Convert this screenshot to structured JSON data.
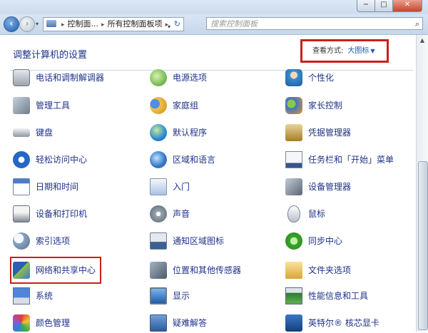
{
  "window": {
    "controls": {
      "minimize": "−",
      "maximize": "□",
      "close": "✕"
    }
  },
  "navbar": {
    "breadcrumb": [
      "控制面...",
      "所有控制面板项"
    ],
    "search_placeholder": "搜索控制面板"
  },
  "content": {
    "title": "调整计算机的设置",
    "view_by_label": "查看方式:",
    "view_by_value": "大图标"
  },
  "items": [
    {
      "label": "电话和调制解调器",
      "icon": "phone-modem-icon"
    },
    {
      "label": "电源选项",
      "icon": "power-options-icon"
    },
    {
      "label": "个性化",
      "icon": "personalization-icon"
    },
    {
      "label": "管理工具",
      "icon": "admin-tools-icon"
    },
    {
      "label": "家庭组",
      "icon": "homegroup-icon"
    },
    {
      "label": "家长控制",
      "icon": "parental-controls-icon"
    },
    {
      "label": "键盘",
      "icon": "keyboard-icon"
    },
    {
      "label": "默认程序",
      "icon": "default-programs-icon"
    },
    {
      "label": "凭据管理器",
      "icon": "credential-manager-icon"
    },
    {
      "label": "轻松访问中心",
      "icon": "ease-of-access-icon"
    },
    {
      "label": "区域和语言",
      "icon": "region-language-icon"
    },
    {
      "label": "任务栏和「开始」菜单",
      "icon": "taskbar-start-menu-icon"
    },
    {
      "label": "日期和时间",
      "icon": "date-time-icon"
    },
    {
      "label": "入门",
      "icon": "getting-started-icon"
    },
    {
      "label": "设备管理器",
      "icon": "device-manager-icon"
    },
    {
      "label": "设备和打印机",
      "icon": "devices-printers-icon"
    },
    {
      "label": "声音",
      "icon": "sound-icon"
    },
    {
      "label": "鼠标",
      "icon": "mouse-icon"
    },
    {
      "label": "索引选项",
      "icon": "indexing-options-icon"
    },
    {
      "label": "通知区域图标",
      "icon": "notification-area-icon"
    },
    {
      "label": "同步中心",
      "icon": "sync-center-icon"
    },
    {
      "label": "网络和共享中心",
      "icon": "network-sharing-icon"
    },
    {
      "label": "位置和其他传感器",
      "icon": "location-sensors-icon"
    },
    {
      "label": "文件夹选项",
      "icon": "folder-options-icon"
    },
    {
      "label": "系统",
      "icon": "system-icon"
    },
    {
      "label": "显示",
      "icon": "display-icon"
    },
    {
      "label": "性能信息和工具",
      "icon": "performance-tools-icon"
    },
    {
      "label": "颜色管理",
      "icon": "color-management-icon"
    },
    {
      "label": "疑难解答",
      "icon": "troubleshooting-icon"
    },
    {
      "label": "英特尔® 核芯显卡",
      "icon": "intel-graphics-icon"
    }
  ],
  "colors": {
    "link": "#1e3287",
    "highlight_border": "#c8201c",
    "view_by_link": "#1a55b9"
  }
}
